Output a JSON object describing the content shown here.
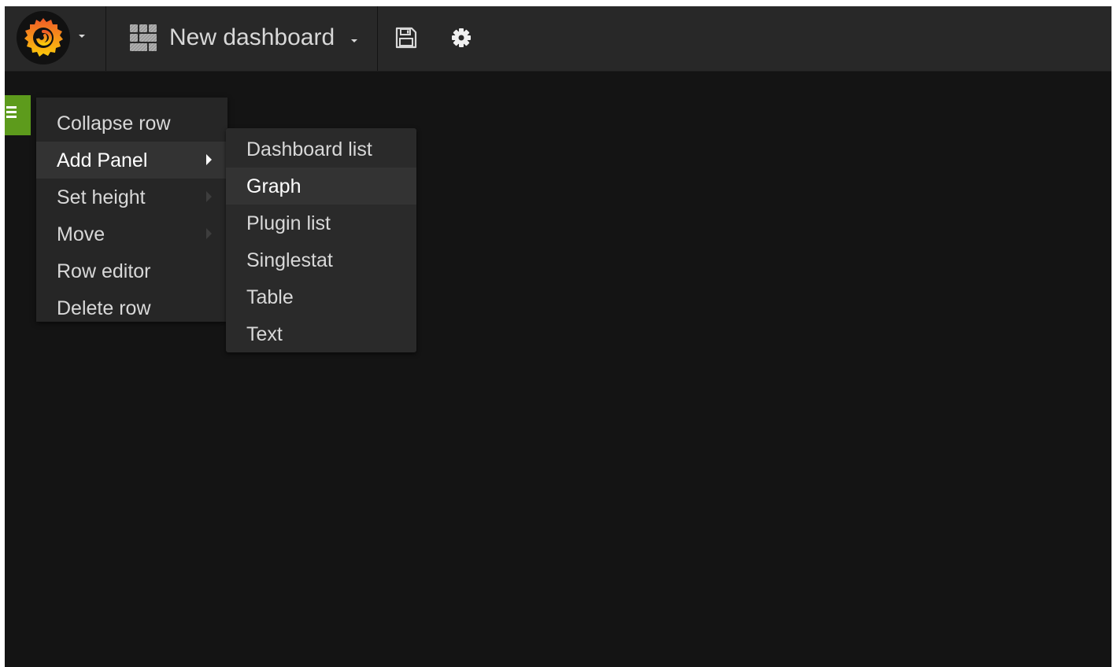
{
  "navbar": {
    "dashboard_title": "New dashboard",
    "icons": {
      "logo": "grafana-logo-icon",
      "dashboard": "dashboard-grid-icon",
      "save": "save-icon",
      "settings": "gear-icon"
    }
  },
  "row_menu": {
    "items": [
      {
        "label": "Collapse row",
        "has_submenu": false
      },
      {
        "label": "Add Panel",
        "has_submenu": true,
        "active": true
      },
      {
        "label": "Set height",
        "has_submenu": true
      },
      {
        "label": "Move",
        "has_submenu": true
      },
      {
        "label": "Row editor",
        "has_submenu": false
      },
      {
        "label": "Delete row",
        "has_submenu": false
      }
    ]
  },
  "add_panel_submenu": {
    "items": [
      {
        "label": "Dashboard list"
      },
      {
        "label": "Graph",
        "active": true
      },
      {
        "label": "Plugin list"
      },
      {
        "label": "Singlestat"
      },
      {
        "label": "Table"
      },
      {
        "label": "Text"
      }
    ]
  },
  "colors": {
    "background": "#141414",
    "navbar": "#282828",
    "menu": "#262626",
    "row_handle": "#5d9b1c",
    "logo_orange": "#f05a28",
    "logo_yellow": "#fbca0a"
  }
}
